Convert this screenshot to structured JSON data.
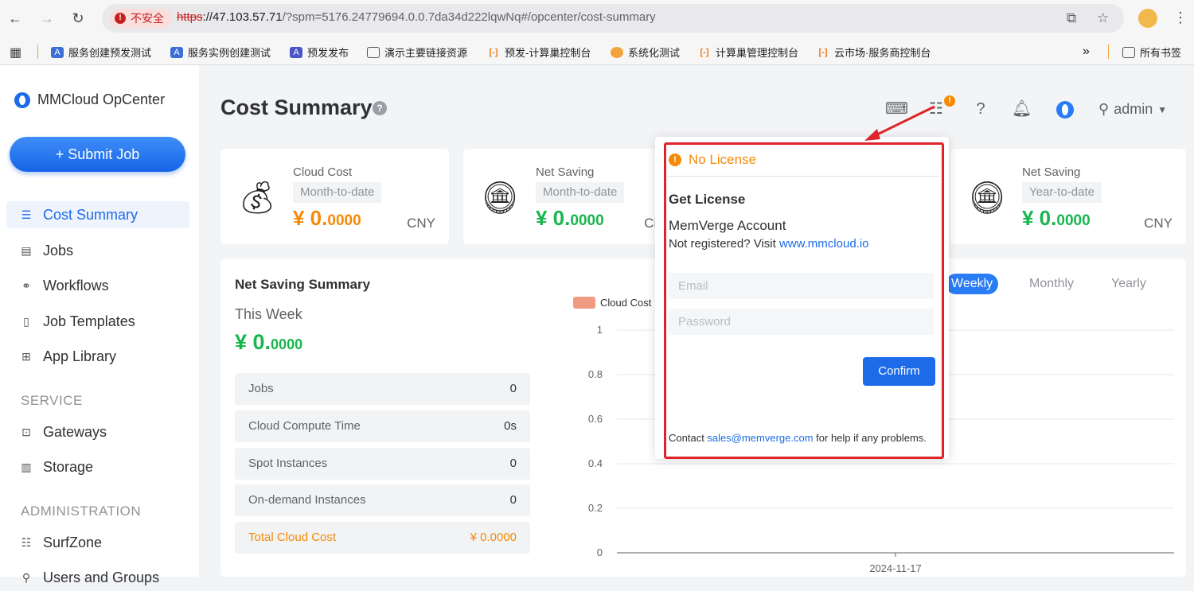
{
  "browser": {
    "insecure_label": "不安全",
    "url_scheme": "https",
    "url_host": "://47.103.57.71",
    "url_rest": "/?spm=5176.24779694.0.0.7da34d222lqwNq#/opcenter/cost-summary",
    "bookmarks": [
      "服务创建预发测试",
      "服务实例创建测试",
      "预发发布",
      "演示主要链接资源",
      "预发-计算巢控制台",
      "系统化测试",
      "计算巢管理控制台",
      "云市场·服务商控制台"
    ],
    "more_label": "»",
    "all_bookmarks": "所有书签"
  },
  "sidebar": {
    "logo_text": "MMCloud OpCenter",
    "submit_label": "+ Submit Job",
    "items": [
      {
        "label": "Cost Summary",
        "icon": "list-icon"
      },
      {
        "label": "Jobs",
        "icon": "jobs-icon"
      },
      {
        "label": "Workflows",
        "icon": "workflow-icon"
      },
      {
        "label": "Job Templates",
        "icon": "template-icon"
      },
      {
        "label": "App Library",
        "icon": "grid-icon"
      }
    ],
    "service_header": "SERVICE",
    "service_items": [
      {
        "label": "Gateways",
        "icon": "gateway-icon"
      },
      {
        "label": "Storage",
        "icon": "storage-icon"
      }
    ],
    "admin_header": "ADMINISTRATION",
    "admin_items": [
      {
        "label": "SurfZone",
        "icon": "sliders-icon"
      },
      {
        "label": "Users and Groups",
        "icon": "user-icon"
      }
    ]
  },
  "header": {
    "title": "Cost Summary",
    "notice_badge": "!",
    "user": "admin"
  },
  "cards": [
    {
      "label": "Cloud Cost",
      "period": "Month-to-date",
      "amount_int": "¥ 0.",
      "amount_dec": "0000",
      "currency": "CNY",
      "color": "#f58a07"
    },
    {
      "label": "Net Saving",
      "period": "Month-to-date",
      "amount_int": "¥ 0.",
      "amount_dec": "0000",
      "currency": "CNY",
      "color": "#18b64f"
    },
    {
      "label": "Net Saving",
      "period": "Year-to-date",
      "amount_int": "¥ 0.",
      "amount_dec": "0000",
      "currency": "CNY",
      "color": "#18b64f"
    }
  ],
  "summary": {
    "title": "Net Saving Summary",
    "period_label": "This Week",
    "amount_int": "¥ 0.",
    "amount_dec": "0000",
    "rows": [
      {
        "key": "Jobs",
        "value": "0"
      },
      {
        "key": "Cloud Compute Time",
        "value": "0s"
      },
      {
        "key": "Spot Instances",
        "value": "0"
      },
      {
        "key": "On-demand Instances",
        "value": "0"
      },
      {
        "key": "Total Cloud Cost",
        "value": "¥ 0.0000"
      }
    ],
    "tabs": [
      "Weekly",
      "Monthly",
      "Yearly"
    ],
    "active_tab": "Weekly"
  },
  "chart_data": {
    "type": "line",
    "series": [
      {
        "name": "Cloud Cost",
        "values": [
          0
        ]
      }
    ],
    "categories": [
      "2024-11-17"
    ],
    "ylim": [
      0,
      1
    ],
    "yticks": [
      "0",
      "0.2",
      "0.4",
      "0.6",
      "0.8",
      "1"
    ],
    "legend_color": "#f19a82",
    "grid": true
  },
  "popup": {
    "warning": "No License",
    "heading": "Get License",
    "account": "MemVerge Account",
    "register_prefix": "Not registered? Visit ",
    "register_link": "www.mmcloud.io",
    "email_placeholder": "Email",
    "password_placeholder": "Password",
    "confirm_label": "Confirm",
    "contact_prefix": "Contact ",
    "contact_email": "sales@memverge.com",
    "contact_suffix": " for help if any problems."
  }
}
